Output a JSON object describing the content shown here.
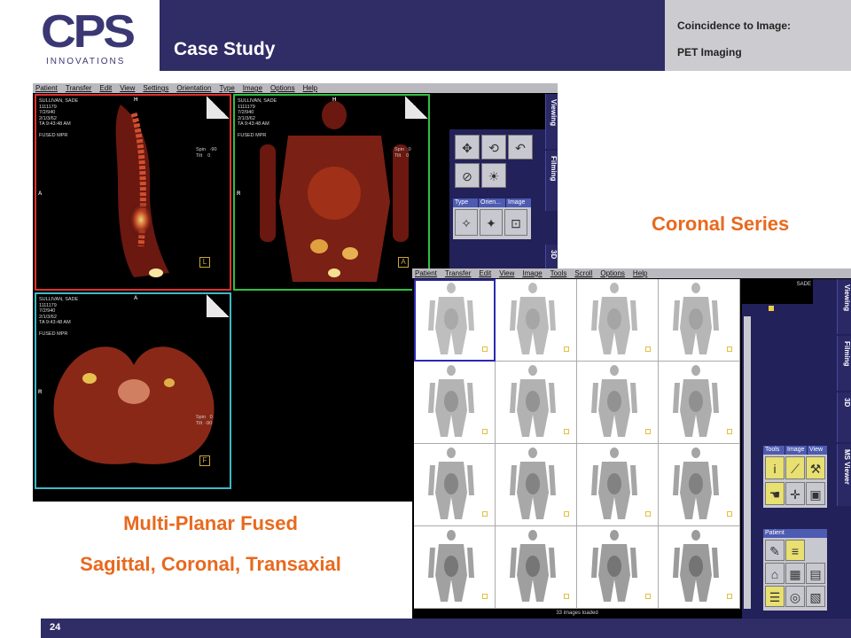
{
  "header": {
    "logo_text": "CPS",
    "logo_subtext": "INNOVATIONS",
    "title": "Case Study",
    "right_line1": "Coincidence to Image:",
    "right_line2": "PET Imaging"
  },
  "footer": {
    "page_number": "24"
  },
  "captions": {
    "coronal_series": "Coronal Series",
    "mpf_line1": "Multi-Planar Fused",
    "mpf_line2": "Sagittal, Coronal, Transaxial"
  },
  "mpr_window": {
    "menu": [
      "Patient",
      "Transfer",
      "Edit",
      "View",
      "Settings",
      "Orientation",
      "Type",
      "Image",
      "Options",
      "Help"
    ],
    "tabs": [
      "Viewing",
      "Filming",
      "3D"
    ],
    "palette_headers": [
      "Type",
      "Orien...",
      "Image"
    ],
    "viewports": [
      {
        "info": "SULLIVAN, SADE\n1111179\n7/2/940\n2/1/3/62\nTA 9:43:48 AM\n\nFUSED MPR",
        "spin": "Spin   -90\nTilt    0",
        "letter": "L",
        "top_label": "H",
        "left_label": "A",
        "right_label": ""
      },
      {
        "info": "SULLIVAN, SADE\n1111179\n7/2/940\n2/1/3/62\nTA 9:43:48 AM\n\nFUSED MPR",
        "spin": "Spin   0\nTilt    0",
        "letter": "A",
        "top_label": "H",
        "left_label": "R",
        "right_label": ""
      },
      {
        "info": "SULLIVAN, SADE\n1111179\n7/2/940\n2/1/3/62\nTA 9:43:48 AM\n\nFUSED MPR",
        "spin": "Spin   0\nTilt  -90",
        "letter": "F",
        "top_label": "A",
        "left_label": "R",
        "right_label": ""
      }
    ]
  },
  "coronal_window": {
    "menu": [
      "Patient",
      "Transfer",
      "Edit",
      "View",
      "Image",
      "Tools",
      "Scroll",
      "Options",
      "Help"
    ],
    "tabs": [
      "Viewing",
      "Filming",
      "3D",
      "MS Viewer"
    ],
    "patient_name_fragment": "SADE",
    "palette_headers": [
      "Tools",
      "Image",
      "View"
    ],
    "patient_palette": "Patient",
    "status": "33 images loaded"
  },
  "colors": {
    "header_navy": "#2f2c66",
    "accent_orange": "#e8691e",
    "viewport_red": "#e03030",
    "viewport_green": "#30c040",
    "viewport_cyan": "#40b8c8"
  }
}
